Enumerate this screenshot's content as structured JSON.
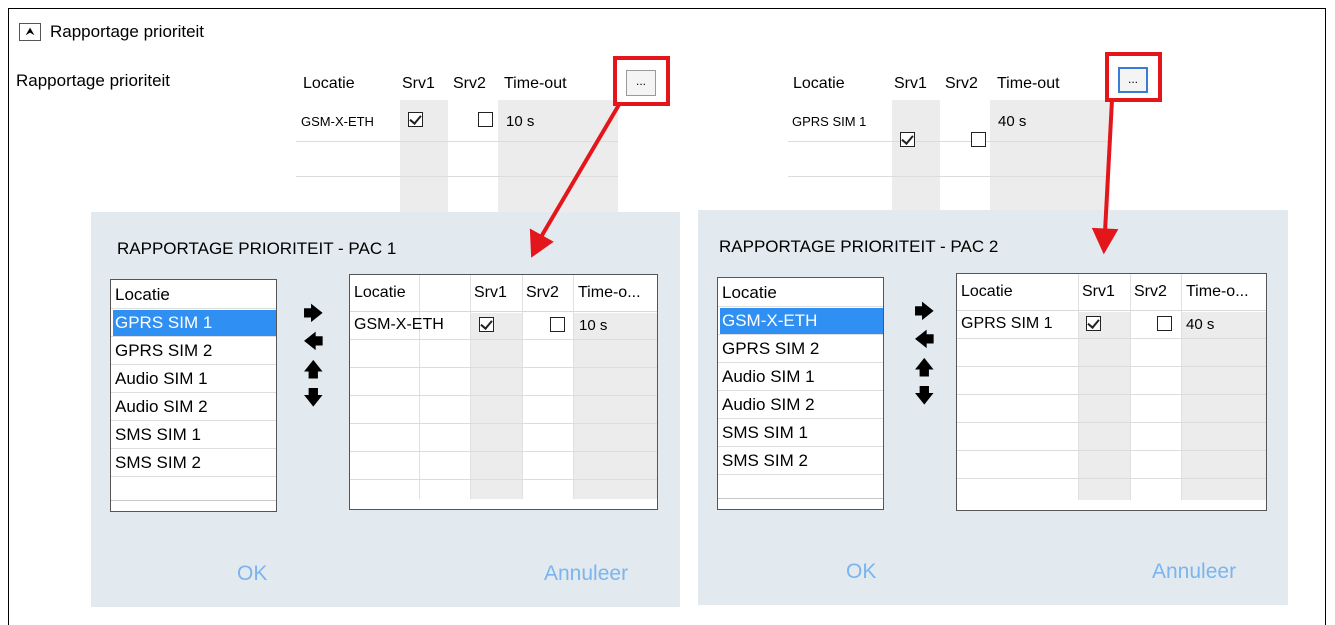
{
  "section": {
    "toggle_icon": "double-chevron-up-icon",
    "toggle_glyph": "⮝",
    "title": "Rapportage prioriteit"
  },
  "row_label": "Rapportage prioriteit",
  "pac1_table": {
    "headers": [
      "Locatie",
      "Srv1",
      "Srv2",
      "Time-out"
    ],
    "rows": [
      {
        "locatie": "GSM-X-ETH",
        "srv1": true,
        "srv2": false,
        "timeout": "10 s"
      }
    ],
    "edit_button": "..."
  },
  "pac2_table": {
    "headers": [
      "Locatie",
      "Srv1",
      "Srv2",
      "Time-out"
    ],
    "rows": [
      {
        "locatie": "GPRS SIM 1",
        "srv1": true,
        "srv2": false,
        "timeout": "40 s"
      }
    ],
    "edit_button": "..."
  },
  "dialog1": {
    "title": "RAPPORTAGE PRIORITEIT - PAC 1",
    "list_header": "Locatie",
    "list_items": [
      "GPRS SIM 1",
      "GPRS SIM 2",
      "Audio SIM 1",
      "Audio SIM 2",
      "SMS SIM 1",
      "SMS SIM 2"
    ],
    "selected_index": 0,
    "table_headers": [
      "Locatie",
      "Srv1",
      "Srv2",
      "Time-o..."
    ],
    "table_rows": [
      {
        "locatie": "GSM-X-ETH",
        "srv1": true,
        "srv2": false,
        "timeout": "10 s"
      }
    ],
    "ok": "OK",
    "cancel": "Annuleer"
  },
  "dialog2": {
    "title": "RAPPORTAGE PRIORITEIT - PAC 2",
    "list_header": "Locatie",
    "list_items": [
      "GSM-X-ETH",
      "GPRS SIM 2",
      "Audio SIM 1",
      "Audio SIM 2",
      "SMS SIM 1",
      "SMS SIM 2"
    ],
    "selected_index": 0,
    "table_headers": [
      "Locatie",
      "Srv1",
      "Srv2",
      "Time-o..."
    ],
    "table_rows": [
      {
        "locatie": "GPRS SIM 1",
        "srv1": true,
        "srv2": false,
        "timeout": "40 s"
      }
    ],
    "ok": "OK",
    "cancel": "Annuleer"
  },
  "arrow_glyphs": {
    "right": "🡆",
    "left": "🡄",
    "up": "🡅",
    "down": "🡇"
  },
  "colors": {
    "highlight_red": "#e3161b",
    "selection_blue": "#2f8ff2",
    "dialog_bg": "#e2eaef",
    "button_text": "#7bb4ef"
  }
}
